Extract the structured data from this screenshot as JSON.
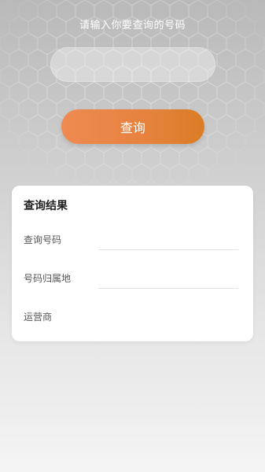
{
  "query": {
    "prompt": "请输入你要查询的号码",
    "input_value": "",
    "input_placeholder": "",
    "button_label": "查询"
  },
  "result": {
    "title": "查询结果",
    "rows": [
      {
        "label": "查询号码",
        "value": ""
      },
      {
        "label": "号码归属地",
        "value": ""
      },
      {
        "label": "运营商",
        "value": ""
      }
    ]
  },
  "colors": {
    "button_start": "#ef8a52",
    "button_end": "#db7c25",
    "card_bg": "#ffffff"
  }
}
